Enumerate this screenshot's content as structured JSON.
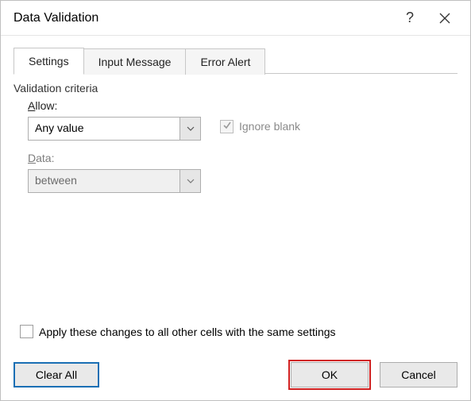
{
  "window": {
    "title": "Data Validation",
    "help_symbol": "?"
  },
  "tabs": {
    "settings": "Settings",
    "input_message": "Input Message",
    "error_alert": "Error Alert"
  },
  "criteria": {
    "legend": "Validation criteria",
    "allow_label": "Allow:",
    "allow_value": "Any value",
    "ignore_blank_label": "Ignore blank",
    "data_label": "Data:",
    "data_value": "between"
  },
  "apply_changes_label": "Apply these changes to all other cells with the same settings",
  "buttons": {
    "clear_all": "Clear All",
    "ok": "OK",
    "cancel": "Cancel"
  }
}
